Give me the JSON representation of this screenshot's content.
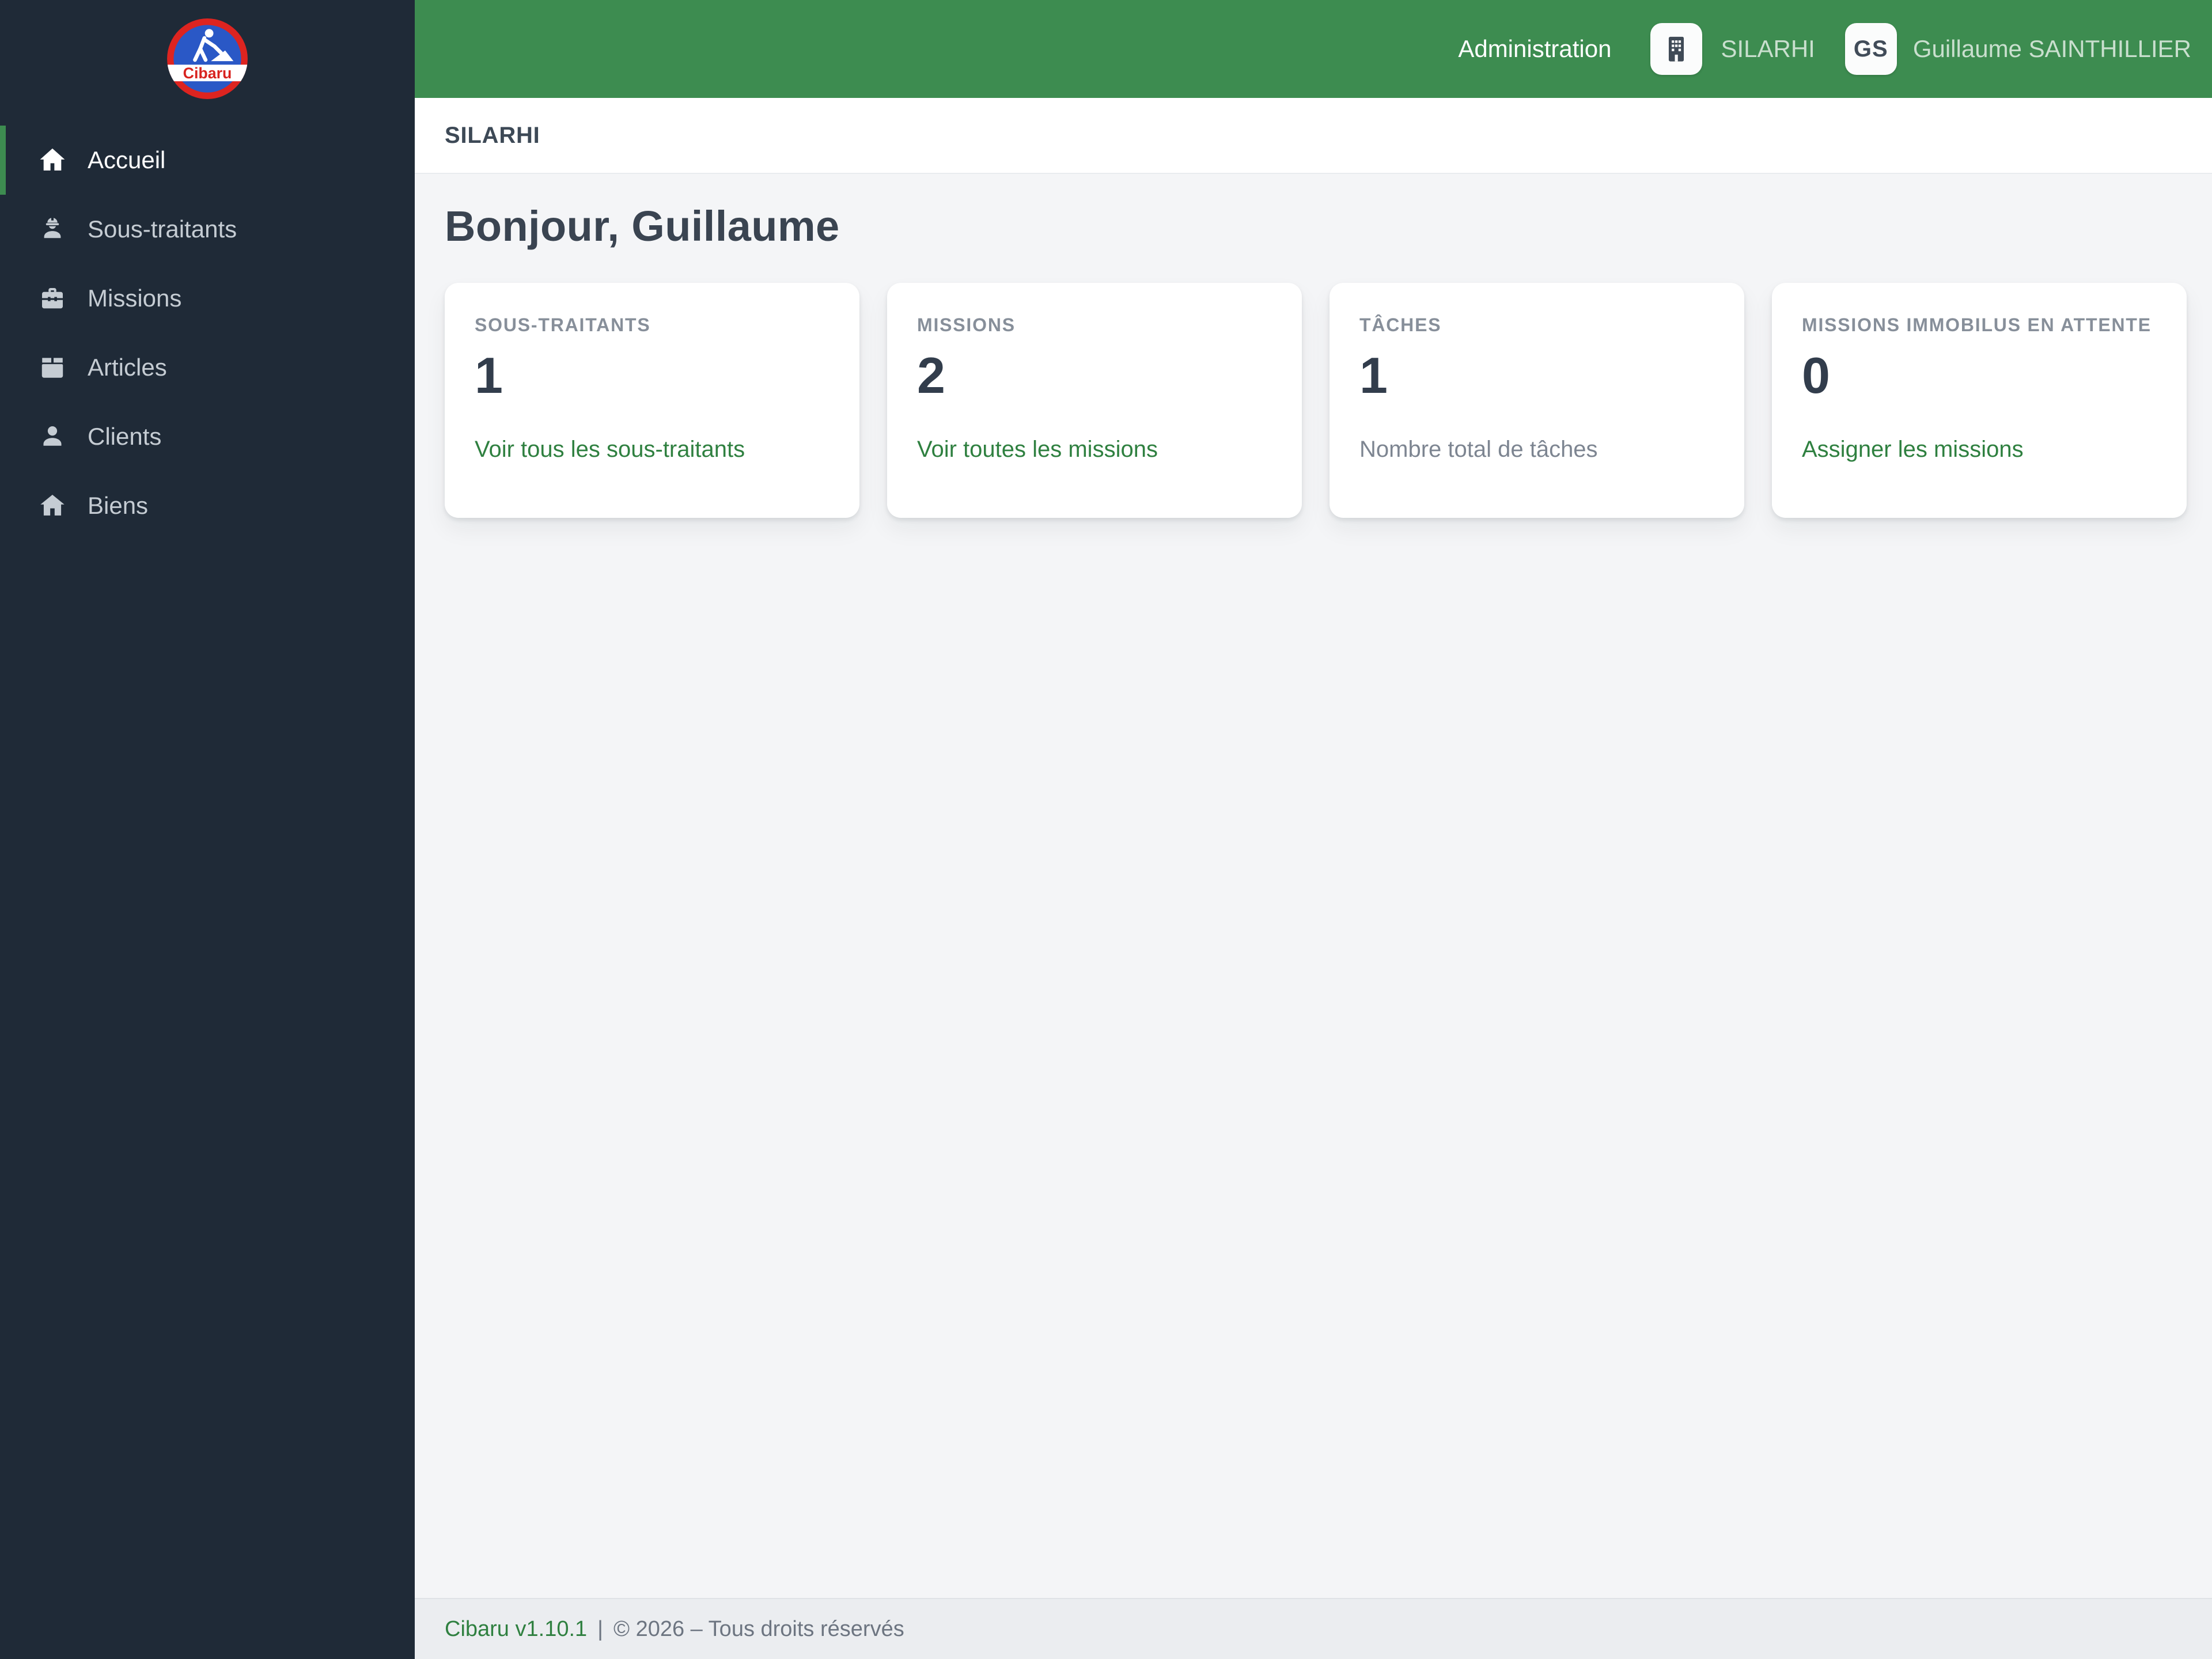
{
  "colors": {
    "header_green": "#3d8c50",
    "active_green": "#3d8c50",
    "link_green": "#2f8040",
    "sidebar_bg": "#1f2a37",
    "logo_red": "#dd2420",
    "logo_blue": "#2a58c6"
  },
  "sidebar": {
    "logo_text": "Cibaru",
    "items": [
      {
        "label": "Accueil",
        "icon": "home",
        "active": true
      },
      {
        "label": "Sous-traitants",
        "icon": "worker"
      },
      {
        "label": "Missions",
        "icon": "toolbox"
      },
      {
        "label": "Articles",
        "icon": "package"
      },
      {
        "label": "Clients",
        "icon": "person"
      },
      {
        "label": "Biens",
        "icon": "house"
      }
    ]
  },
  "header": {
    "admin_label": "Administration",
    "org_name": "SILARHI",
    "user_initials": "GS",
    "user_name": "Guillaume SAINTHILLIER"
  },
  "breadcrumb": {
    "current": "SILARHI"
  },
  "main": {
    "greeting": "Bonjour, Guillaume",
    "cards": [
      {
        "label": "SOUS-TRAITANTS",
        "value": "1",
        "link": "Voir tous les sous-traitants"
      },
      {
        "label": "MISSIONS",
        "value": "2",
        "link": "Voir toutes les missions"
      },
      {
        "label": "TÂCHES",
        "value": "1",
        "note": "Nombre total de tâches"
      },
      {
        "label": "MISSIONS IMMOBILUS EN ATTENTE",
        "value": "0",
        "link": "Assigner les missions"
      }
    ]
  },
  "footer": {
    "version": "Cibaru v1.10.1",
    "separator": "|",
    "copyright": "© 2026 – Tous droits réservés"
  }
}
